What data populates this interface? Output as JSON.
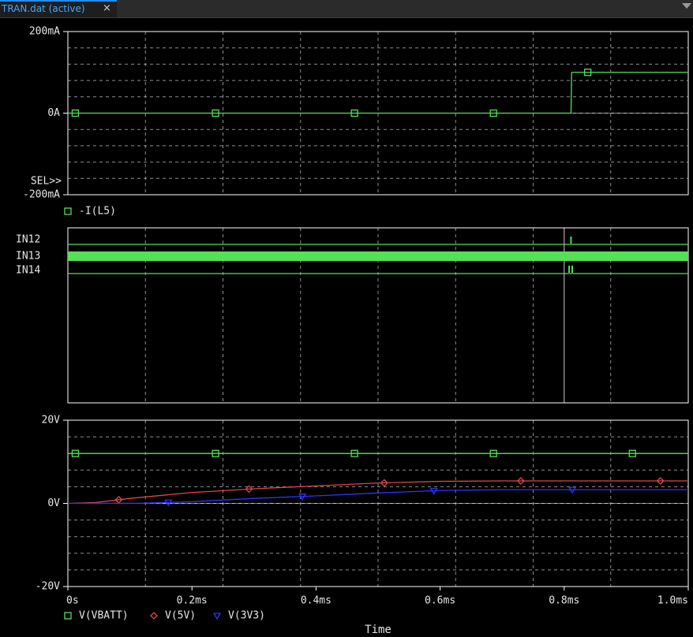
{
  "tab": {
    "title": "TRAN.dat (active)",
    "close_glyph": "×",
    "scroll_icon": "chevron-down-icon"
  },
  "colors": {
    "background": "#000000",
    "grid": "#bdbdbd",
    "axis": "#ffffff",
    "green": "#55e055",
    "red": "#e04545",
    "blue": "#3232ff",
    "label": "#e6e6e6"
  },
  "chart_data": [
    {
      "id": "current",
      "type": "line",
      "x_range": [
        0,
        1.0
      ],
      "y_range": [
        -200,
        200
      ],
      "y_ticks": [
        {
          "value": 200,
          "label": "200mA"
        },
        {
          "value": 0,
          "label": "0A"
        },
        {
          "value": -200,
          "label": "-200mA"
        }
      ],
      "selector_label": "SEL>>",
      "legend": [
        {
          "name": "-I(L5)",
          "marker": "square",
          "color": "#55e055"
        }
      ],
      "series": [
        {
          "name": "-I(L5)",
          "color": "#55e055",
          "marker": "square",
          "x": [
            0,
            0.811,
            0.812,
            1.0
          ],
          "y": [
            0,
            0,
            100,
            100
          ],
          "marker_x": [
            0.012,
            0.238,
            0.462,
            0.686,
            0.838
          ]
        }
      ]
    },
    {
      "id": "digital",
      "type": "digital",
      "x_range": [
        0,
        1.0
      ],
      "signals": [
        {
          "name": "IN12",
          "style": "line",
          "glitches": [
            0.811
          ]
        },
        {
          "name": "IN13",
          "style": "bus",
          "glitches": []
        },
        {
          "name": "IN14",
          "style": "line",
          "glitches": [
            0.808,
            0.813
          ]
        }
      ]
    },
    {
      "id": "voltage",
      "type": "line",
      "x_range": [
        0,
        1.0
      ],
      "y_range": [
        -20,
        20
      ],
      "y_ticks": [
        {
          "value": 20,
          "label": "20V"
        },
        {
          "value": 0,
          "label": "0V"
        },
        {
          "value": -20,
          "label": "-20V"
        }
      ],
      "x_ticks": [
        {
          "value": 0,
          "label": "0s"
        },
        {
          "value": 0.2,
          "label": "0.2ms"
        },
        {
          "value": 0.4,
          "label": "0.4ms"
        },
        {
          "value": 0.6,
          "label": "0.6ms"
        },
        {
          "value": 0.8,
          "label": "0.8ms"
        },
        {
          "value": 1.0,
          "label": "1.0ms"
        }
      ],
      "xlabel": "Time",
      "legend": [
        {
          "name": "V(VBATT)",
          "marker": "square",
          "color": "#55e055"
        },
        {
          "name": "V(5V)",
          "marker": "diamond",
          "color": "#e04545"
        },
        {
          "name": "V(3V3)",
          "marker": "triangle",
          "color": "#3232ff"
        }
      ],
      "series": [
        {
          "name": "V(VBATT)",
          "color": "#55e055",
          "marker": "square",
          "x": [
            0,
            1.0
          ],
          "y": [
            12,
            12
          ],
          "marker_x": [
            0.012,
            0.238,
            0.462,
            0.686,
            0.91
          ]
        },
        {
          "name": "V(5V)",
          "color": "#e04545",
          "marker": "diamond",
          "x": [
            0,
            0.045,
            0.1,
            0.2,
            0.3,
            0.4,
            0.5,
            0.6,
            0.7,
            0.8,
            1.0
          ],
          "y": [
            0,
            0.2,
            1.2,
            2.6,
            3.5,
            4.2,
            4.9,
            5.3,
            5.4,
            5.4,
            5.4
          ],
          "marker_x": [
            0.082,
            0.292,
            0.51,
            0.73,
            0.955
          ]
        },
        {
          "name": "V(3V3)",
          "color": "#3232ff",
          "marker": "triangle",
          "x": [
            0,
            0.12,
            0.2,
            0.3,
            0.4,
            0.5,
            0.6,
            0.7,
            0.8,
            1.0
          ],
          "y": [
            0,
            0.05,
            0.4,
            1.2,
            1.8,
            2.5,
            3.1,
            3.3,
            3.3,
            3.3
          ],
          "marker_x": [
            0.162,
            0.378,
            0.59,
            0.813
          ]
        }
      ]
    }
  ]
}
